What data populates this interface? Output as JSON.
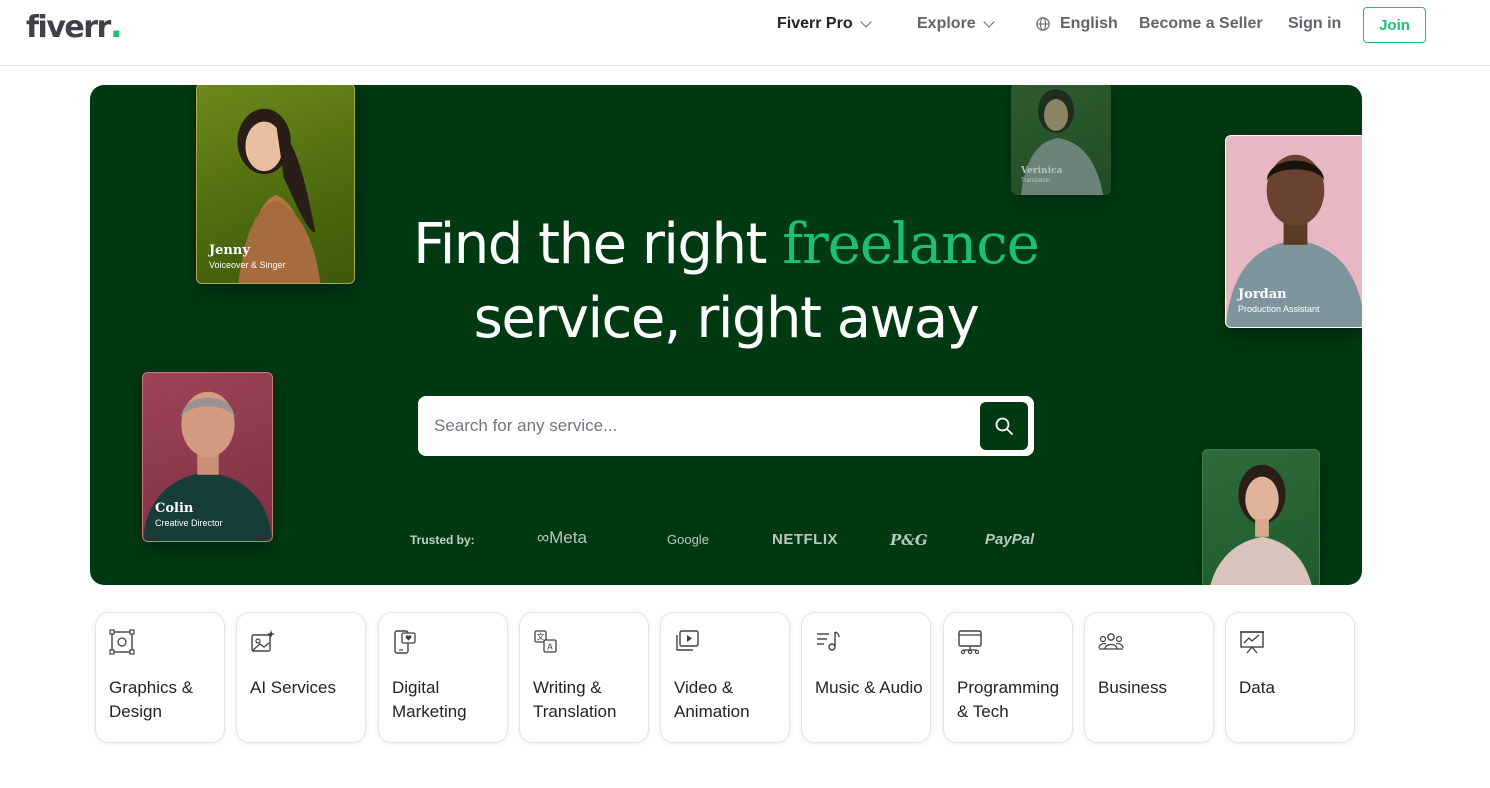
{
  "header": {
    "logo_text": "fiverr",
    "logo_dot": ".",
    "nav": {
      "pro": "Fiverr Pro",
      "explore": "Explore",
      "language": "English",
      "become_seller": "Become a Seller",
      "sign_in": "Sign in",
      "join": "Join"
    }
  },
  "hero": {
    "title_line1_prefix": "Find the right ",
    "title_line1_accent": "freelance",
    "title_line2": "service, right away",
    "search": {
      "placeholder": "Search for any service..."
    },
    "trusted_label": "Trusted by:",
    "brands": [
      "Meta",
      "Google",
      "NETFLIX",
      "P&G",
      "PayPal"
    ],
    "profiles": [
      {
        "name": "Jenny",
        "role": "Voiceover & Singer"
      },
      {
        "name": "Verinica",
        "role": "Translation"
      },
      {
        "name": "Jordan",
        "role": "Production Assistant"
      },
      {
        "name": "Colin",
        "role": "Creative Director"
      }
    ]
  },
  "categories": [
    {
      "label": "Graphics & Design",
      "icon": "graphics-design-icon"
    },
    {
      "label": "AI Services",
      "icon": "ai-services-icon"
    },
    {
      "label": "Digital Marketing",
      "icon": "digital-marketing-icon"
    },
    {
      "label": "Writing & Translation",
      "icon": "writing-translation-icon"
    },
    {
      "label": "Video & Animation",
      "icon": "video-animation-icon"
    },
    {
      "label": "Music & Audio",
      "icon": "music-audio-icon"
    },
    {
      "label": "Programming & Tech",
      "icon": "programming-tech-icon"
    },
    {
      "label": "Business",
      "icon": "business-icon"
    },
    {
      "label": "Data",
      "icon": "data-icon"
    }
  ],
  "colors": {
    "brand_green": "#1dbf73",
    "hero_bg": "#013913",
    "text_dark": "#404145"
  }
}
